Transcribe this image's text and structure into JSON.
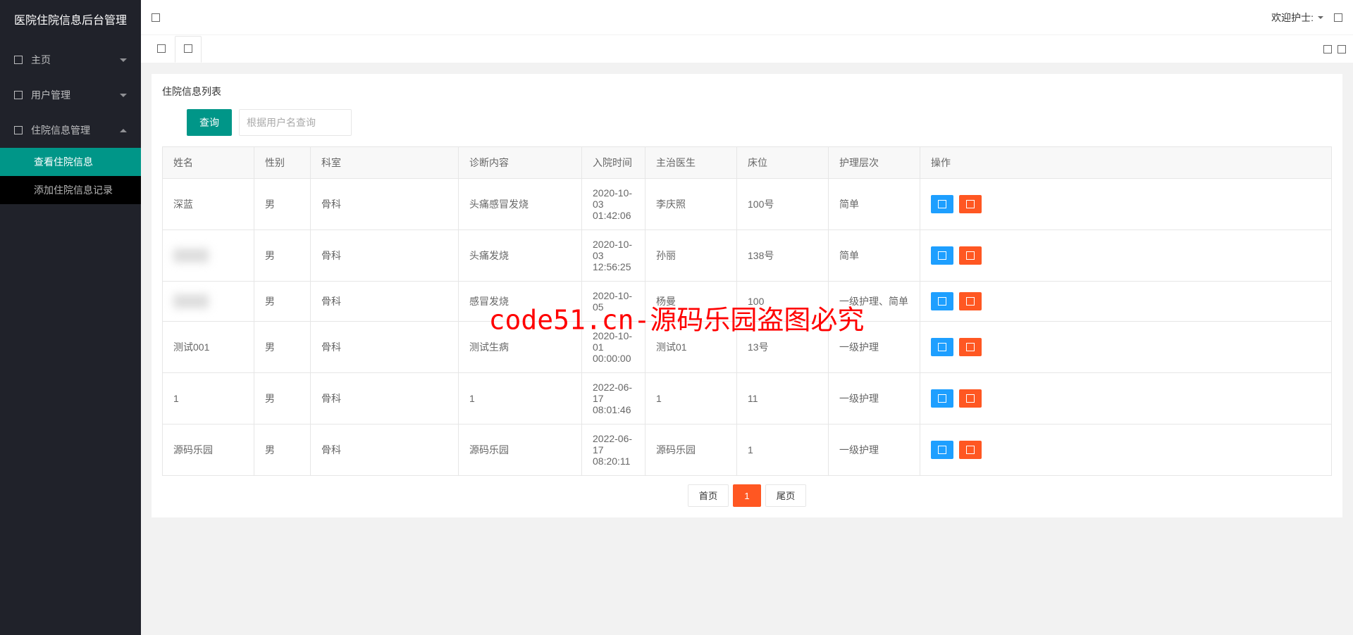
{
  "app_title": "医院住院信息后台管理",
  "header": {
    "welcome": "欢迎护士:"
  },
  "sidebar": {
    "items": [
      {
        "label": "主页",
        "expanded": false
      },
      {
        "label": "用户管理",
        "expanded": false
      },
      {
        "label": "住院信息管理",
        "expanded": true,
        "children": [
          {
            "label": "查看住院信息",
            "active": true
          },
          {
            "label": "添加住院信息记录",
            "active": false
          }
        ]
      }
    ]
  },
  "page": {
    "title": "住院信息列表",
    "search_btn": "查询",
    "search_placeholder": "根据用户名查询"
  },
  "table": {
    "headers": [
      "姓名",
      "性别",
      "科室",
      "诊断内容",
      "入院时间",
      "主治医生",
      "床位",
      "护理层次",
      "操作"
    ],
    "rows": [
      {
        "name": "深蓝",
        "gender": "男",
        "dept": "骨科",
        "diag": "头痛感冒发烧",
        "time": "2020-10-03 01:42:06",
        "doctor": "李庆照",
        "bed": "100号",
        "care": "简单"
      },
      {
        "name": "",
        "gender": "男",
        "dept": "骨科",
        "diag": "头痛发烧",
        "time": "2020-10-03 12:56:25",
        "doctor": "孙丽",
        "bed": "138号",
        "care": "简单"
      },
      {
        "name": "",
        "gender": "男",
        "dept": "骨科",
        "diag": "感冒发烧",
        "time": "2020-10-05",
        "doctor": "杨曼",
        "bed": "100",
        "care": "一级护理、简单"
      },
      {
        "name": "测试001",
        "gender": "男",
        "dept": "骨科",
        "diag": "测试生病",
        "time": "2020-10-01 00:00:00",
        "doctor": "测试01",
        "bed": "13号",
        "care": "一级护理"
      },
      {
        "name": "1",
        "gender": "男",
        "dept": "骨科",
        "diag": "1",
        "time": "2022-06-17 08:01:46",
        "doctor": "1",
        "bed": "11",
        "care": "一级护理"
      },
      {
        "name": "源码乐园",
        "gender": "男",
        "dept": "骨科",
        "diag": "源码乐园",
        "time": "2022-06-17 08:20:11",
        "doctor": "源码乐园",
        "bed": "1",
        "care": "一级护理"
      }
    ]
  },
  "pagination": {
    "first": "首页",
    "current": "1",
    "last": "尾页"
  },
  "watermark": "code51.cn-源码乐园盗图必究"
}
